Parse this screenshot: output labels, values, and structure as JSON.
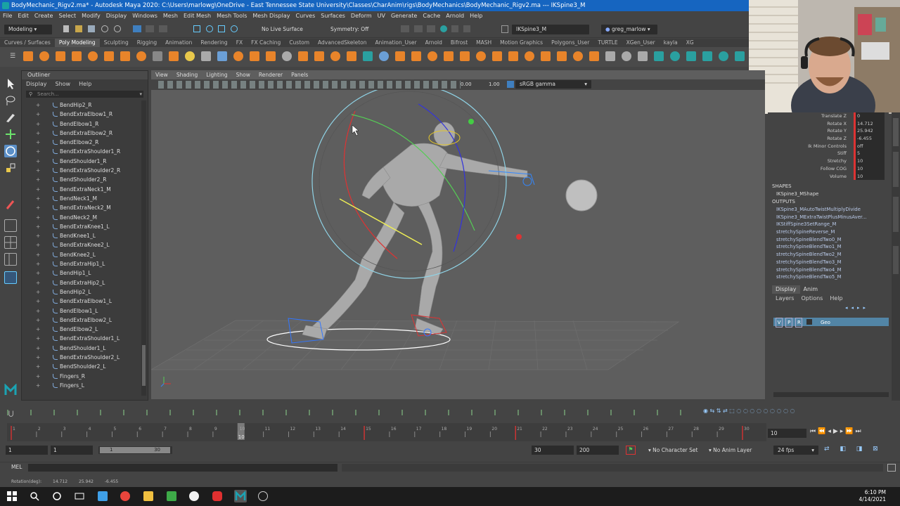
{
  "window": {
    "title": "BodyMechanic_Rigv2.ma* - Autodesk Maya 2020: C:\\Users\\marlowg\\OneDrive - East Tennessee State University\\Classes\\CharAnim\\rigs\\BodyMechanics\\BodyMechanic_Rigv2.ma   ---   IKSpine3_M"
  },
  "menubar": [
    "File",
    "Edit",
    "Create",
    "Select",
    "Modify",
    "Display",
    "Windows",
    "Mesh",
    "Edit Mesh",
    "Mesh Tools",
    "Mesh Display",
    "Curves",
    "Surfaces",
    "Deform",
    "UV",
    "Generate",
    "Cache",
    "Arnold",
    "Help"
  ],
  "statusline": {
    "menuset": "Modeling",
    "live_surface": "No Live Surface",
    "symmetry": "Symmetry: Off",
    "selection_field": "IKSpine3_M",
    "user": "greg_marlow"
  },
  "shelf_tabs": [
    "Curves / Surfaces",
    "Poly Modeling",
    "Sculpting",
    "Rigging",
    "Animation",
    "Rendering",
    "FX",
    "FX Caching",
    "Custom",
    "AdvancedSkeleton",
    "Animation_User",
    "Arnold",
    "Bifrost",
    "MASH",
    "Motion Graphics",
    "Polygons_User",
    "TURTLE",
    "XGen_User",
    "kayla",
    "XG"
  ],
  "shelf_active": "Poly Modeling",
  "outliner": {
    "title": "Outliner",
    "menu": [
      "Display",
      "Show",
      "Help"
    ],
    "search_placeholder": "Search...",
    "items": [
      "BendHip2_R",
      "BendExtraElbow1_R",
      "BendElbow1_R",
      "BendExtraElbow2_R",
      "BendElbow2_R",
      "BendExtraShoulder1_R",
      "BendShoulder1_R",
      "BendExtraShoulder2_R",
      "BendShoulder2_R",
      "BendExtraNeck1_M",
      "BendNeck1_M",
      "BendExtraNeck2_M",
      "BendNeck2_M",
      "BendExtraKnee1_L",
      "BendKnee1_L",
      "BendExtraKnee2_L",
      "BendKnee2_L",
      "BendExtraHip1_L",
      "BendHip1_L",
      "BendExtraHip2_L",
      "BendHip2_L",
      "BendExtraElbow1_L",
      "BendElbow1_L",
      "BendExtraElbow2_L",
      "BendElbow2_L",
      "BendExtraShoulder1_L",
      "BendShoulder1_L",
      "BendExtraShoulder2_L",
      "BendShoulder2_L",
      "Fingers_R",
      "Fingers_L"
    ]
  },
  "viewport": {
    "menu": [
      "View",
      "Shading",
      "Lighting",
      "Show",
      "Renderer",
      "Panels"
    ],
    "value_a": "0.00",
    "value_b": "1.00",
    "color_space": "sRGB gamma"
  },
  "channel_box": {
    "attributes": [
      {
        "name": "Translate Z",
        "value": "0"
      },
      {
        "name": "Rotate X",
        "value": "14.712"
      },
      {
        "name": "Rotate Y",
        "value": "25.942"
      },
      {
        "name": "Rotate Z",
        "value": "-6.455"
      },
      {
        "name": "Ik Minor Controls",
        "value": "off"
      },
      {
        "name": "Stiff",
        "value": "5"
      },
      {
        "name": "Stretchy",
        "value": "10"
      },
      {
        "name": "Follow COG",
        "value": "10"
      },
      {
        "name": "Volume",
        "value": "10"
      }
    ],
    "shapes_label": "SHAPES",
    "shape": "IKSpine3_MShape",
    "outputs_label": "OUTPUTS",
    "outputs": [
      "IKSpine3_MAutoTwistMultiplyDivide",
      "IKSpine3_MExtraTwistPlusMinusAver...",
      "IKStiffSpine3SetRange_M",
      "stretchySpineReverse_M",
      "stretchySpineBlendTwo0_M",
      "stretchySpineBlendTwo1_M",
      "stretchySpineBlendTwo2_M",
      "stretchySpineBlendTwo3_M",
      "stretchySpineBlendTwo4_M",
      "stretchySpineBlendTwo5_M"
    ]
  },
  "layers": {
    "tabs": [
      "Display",
      "Anim"
    ],
    "menu": [
      "Layers",
      "Options",
      "Help"
    ],
    "layer": {
      "v": "V",
      "p": "P",
      "r": "R",
      "name": "Geo"
    }
  },
  "timeline": {
    "ticks": [
      "1",
      "2",
      "3",
      "4",
      "5",
      "6",
      "7",
      "8",
      "9",
      "10",
      "11",
      "12",
      "13",
      "14",
      "15",
      "16",
      "17",
      "18",
      "19",
      "20",
      "21",
      "22",
      "23",
      "24",
      "25",
      "26",
      "27",
      "28",
      "29",
      "30"
    ],
    "current_frame": "10",
    "current_frame_field": "10"
  },
  "range": {
    "start": "1",
    "anim_start": "1",
    "slider_start": "1",
    "slider_end": "30",
    "end": "30",
    "anim_end": "200",
    "character_set": "No Character Set",
    "anim_layer": "No Anim Layer",
    "fps": "24 fps"
  },
  "mel": {
    "label": "MEL"
  },
  "helpline": {
    "label": "Rotation(deg):",
    "x": "14.712",
    "y": "25.942",
    "z": "-6.455"
  },
  "taskbar": {
    "time": "6:10 PM",
    "date": "4/14/2021"
  },
  "colors": {
    "title_blue": "#1665c0",
    "maya_gray": "#444444",
    "viewport_gray": "#5e5e5e",
    "layer_blue": "#5285a6",
    "key_red": "#d33333"
  }
}
